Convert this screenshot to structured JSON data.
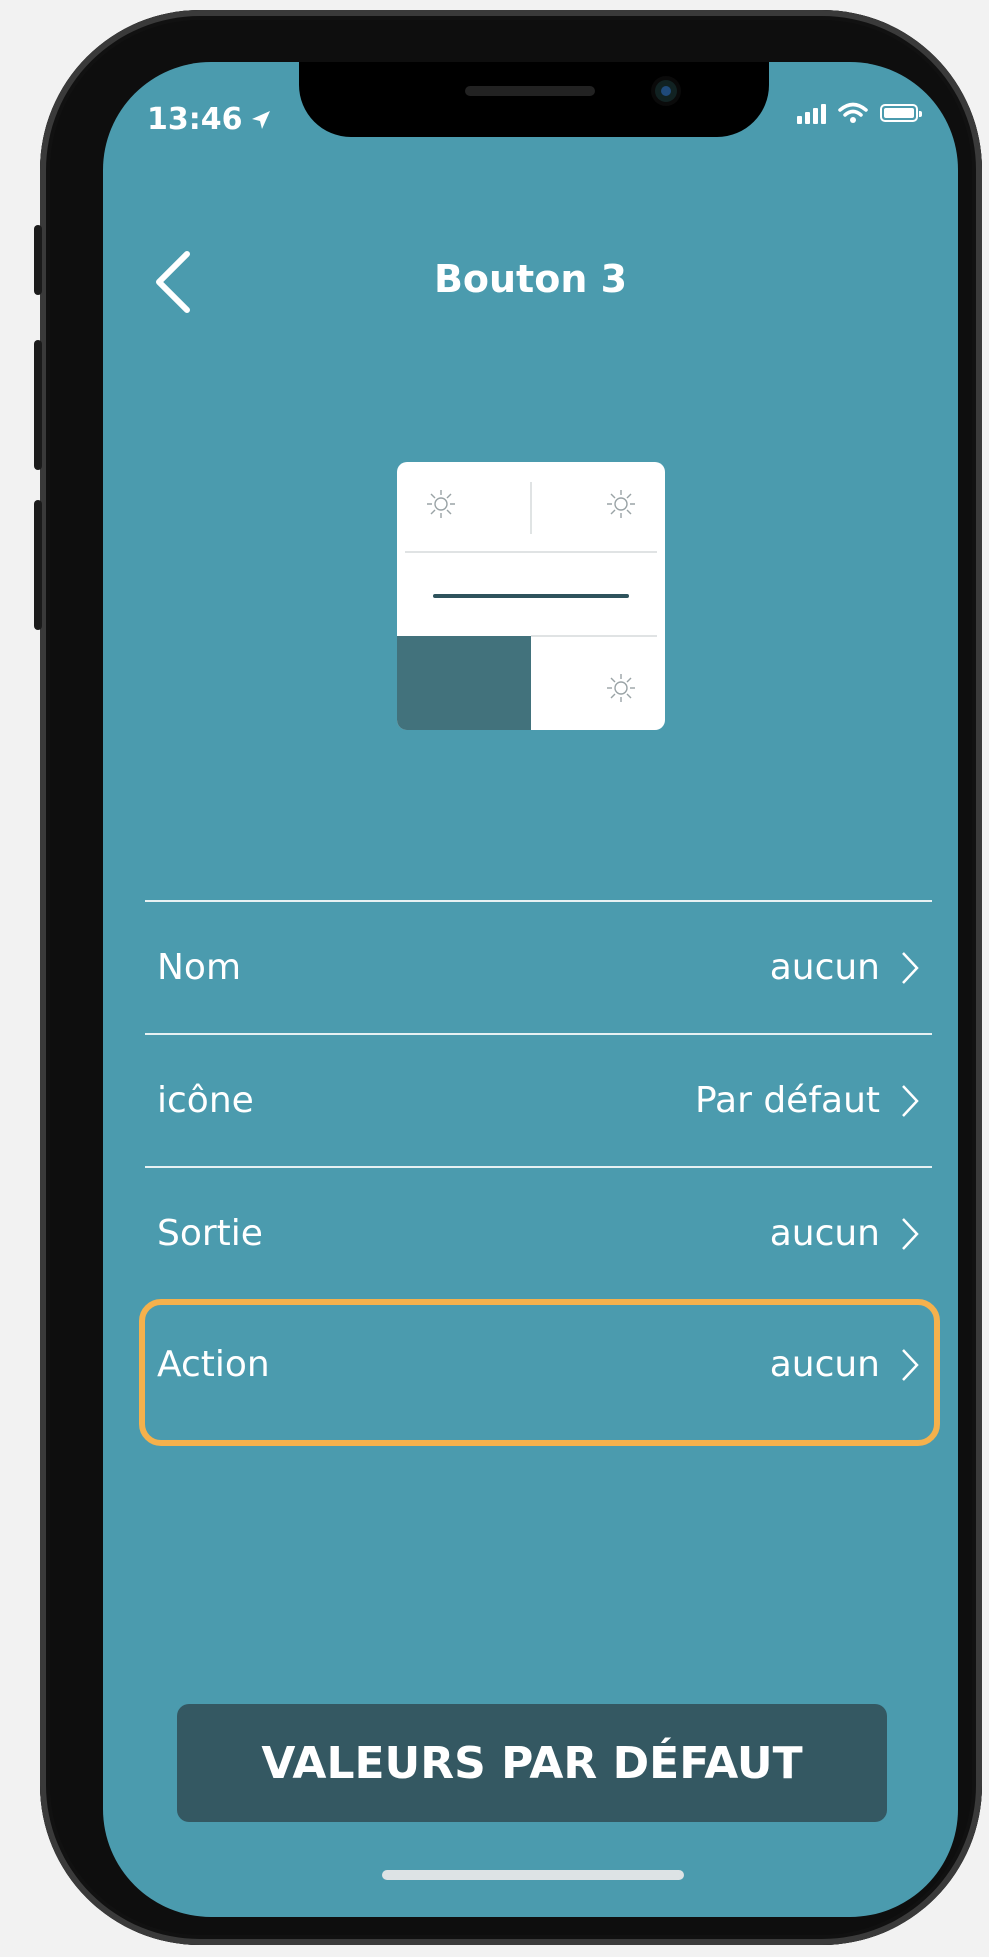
{
  "status_bar": {
    "time": "13:46"
  },
  "header": {
    "title": "Bouton 3"
  },
  "settings": [
    {
      "label": "Nom",
      "value": "aucun",
      "highlighted": false
    },
    {
      "label": "icône",
      "value": "Par défaut",
      "highlighted": false
    },
    {
      "label": "Sortie",
      "value": "aucun",
      "highlighted": false
    },
    {
      "label": "Action",
      "value": "aucun",
      "highlighted": true
    }
  ],
  "footer": {
    "defaults_label": "VALEURS PAR DÉFAUT"
  },
  "colors": {
    "screen_bg": "#4b9bae",
    "button_bg": "#345862",
    "highlight": "#f5b14c",
    "selected_cell": "#42727c"
  }
}
